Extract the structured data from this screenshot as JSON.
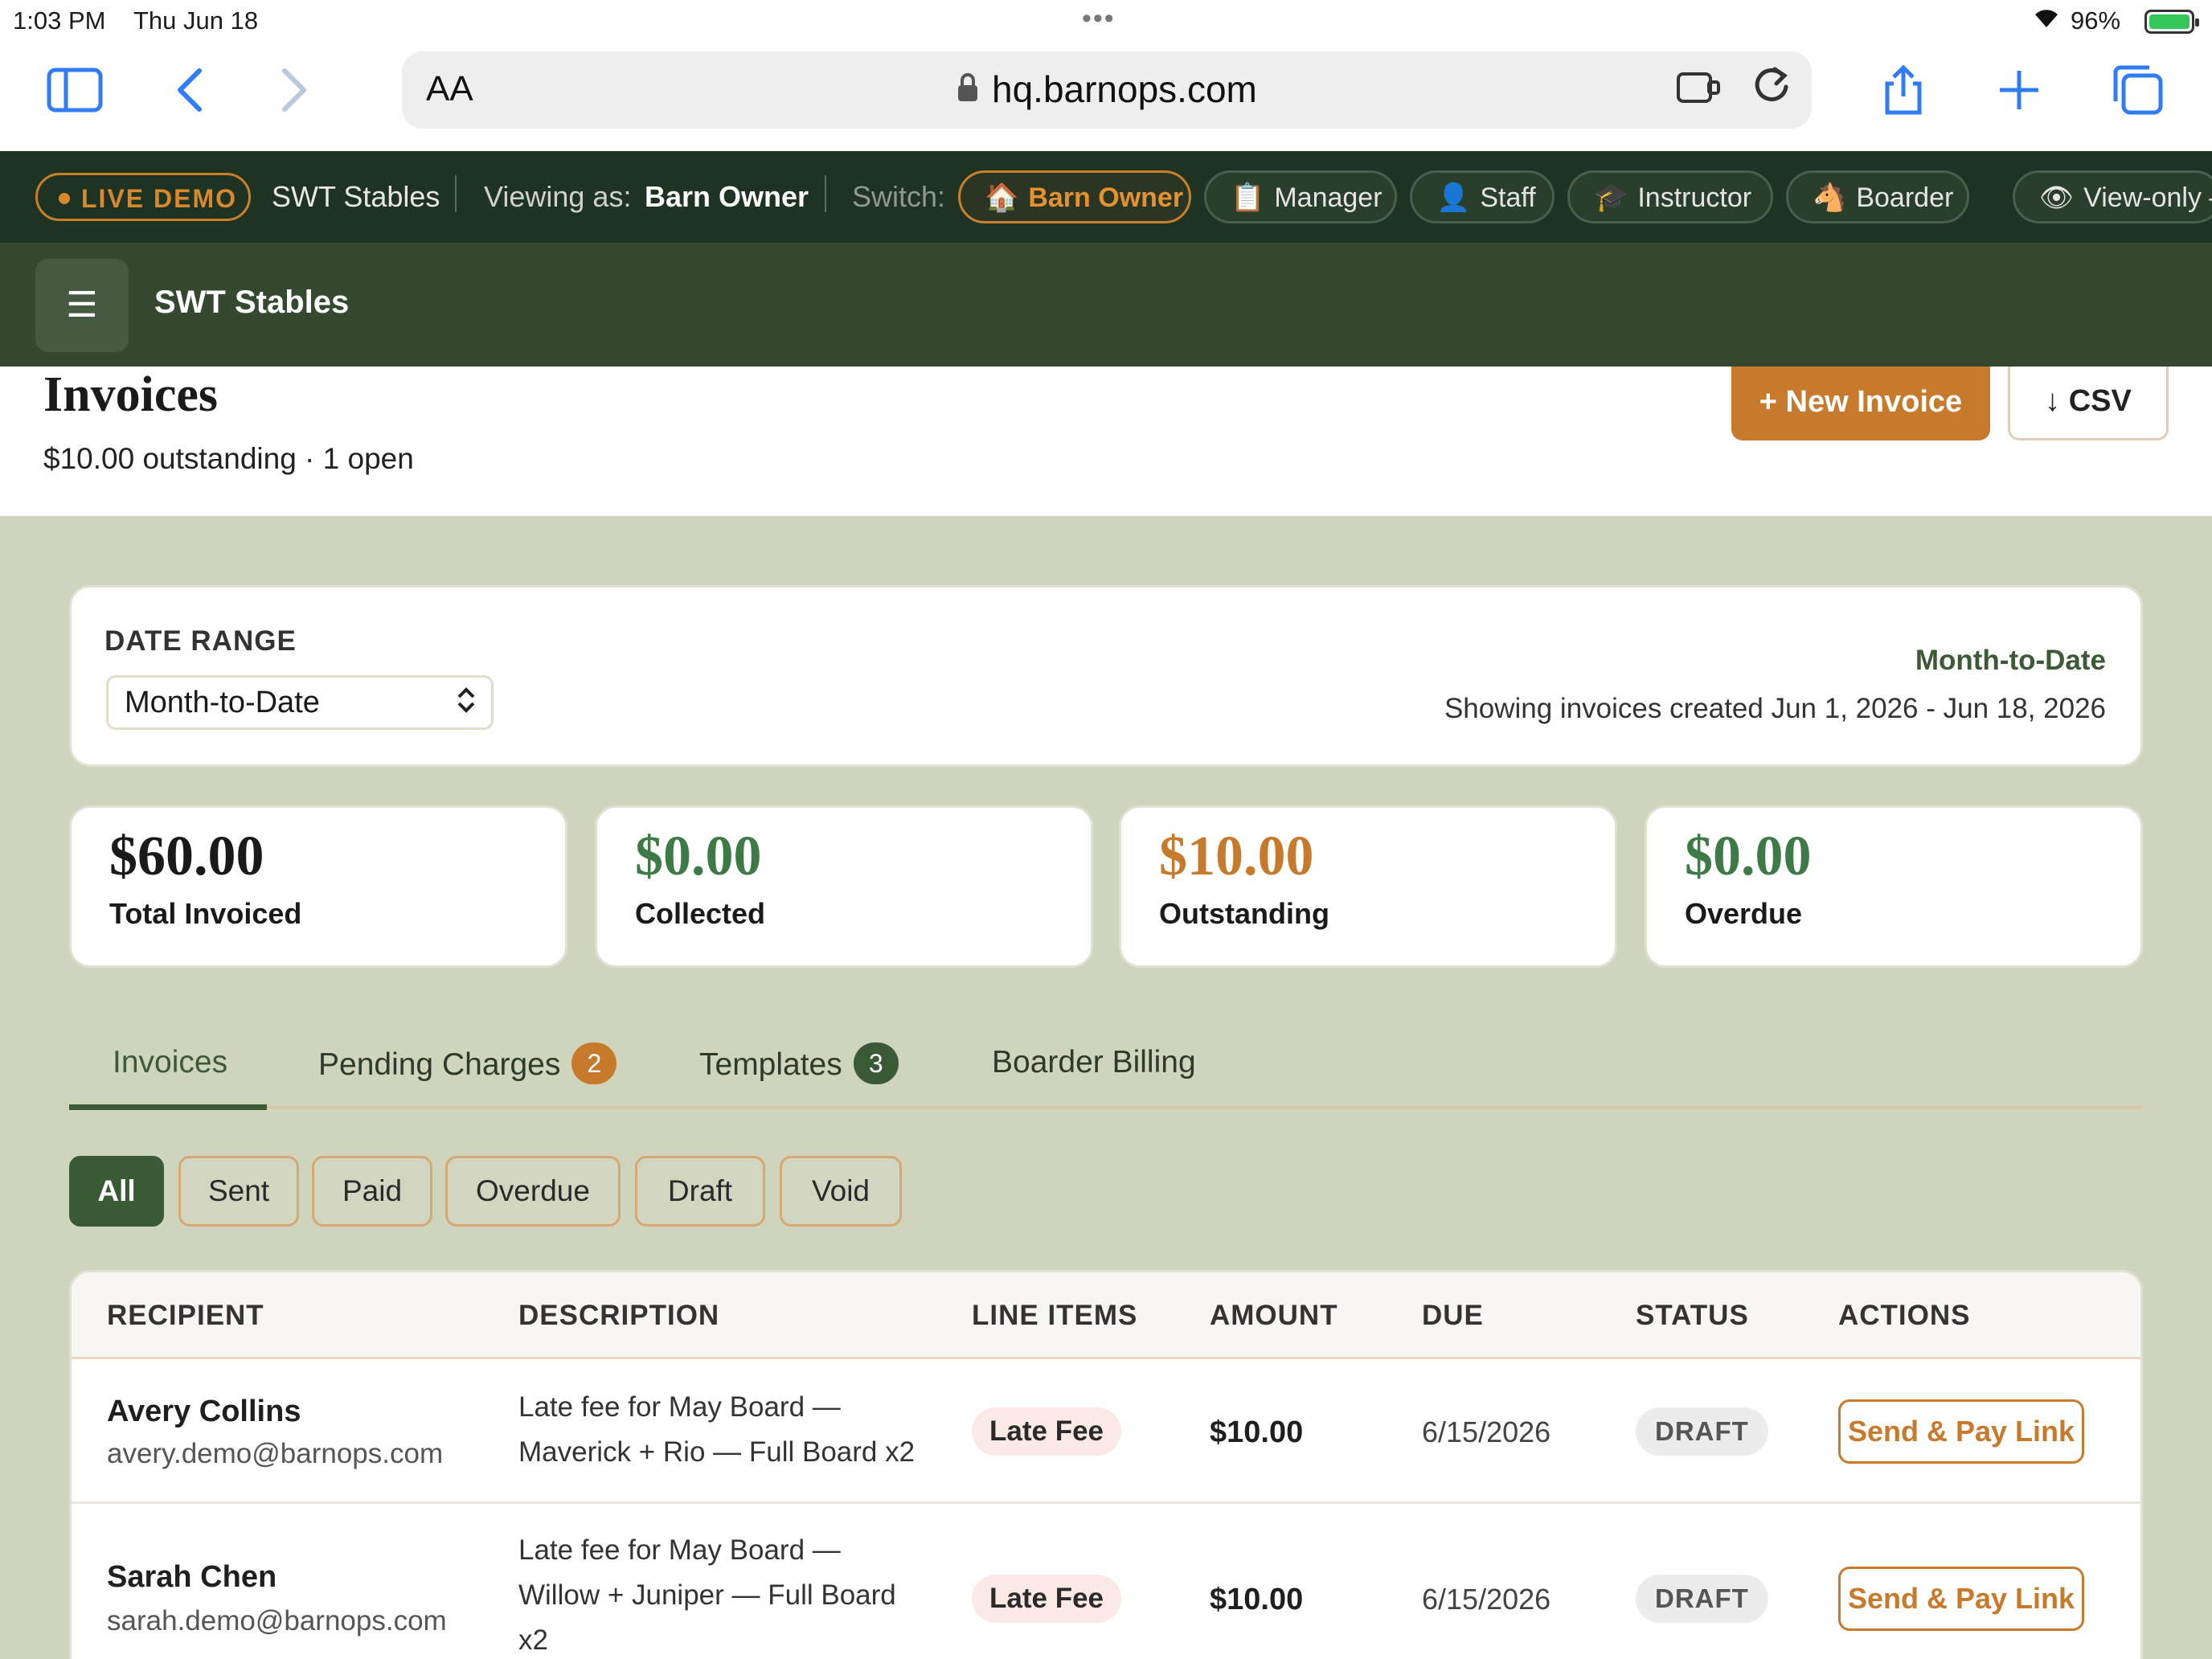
{
  "status_bar": {
    "time": "1:03 PM",
    "date": "Thu Jun 18",
    "battery": "96%"
  },
  "browser": {
    "aa_label": "AA",
    "url": "hq.barnops.com"
  },
  "demo_bar": {
    "live_label": "LIVE DEMO",
    "org": "SWT Stables",
    "viewing_label": "Viewing as:",
    "viewing_role": "Barn Owner",
    "switch_label": "Switch:",
    "roles": [
      {
        "icon": "🏠",
        "label": "Barn Owner"
      },
      {
        "icon": "📋",
        "label": "Manager"
      },
      {
        "icon": "👤",
        "label": "Staff"
      },
      {
        "icon": "🎓",
        "label": "Instructor"
      },
      {
        "icon": "🐴",
        "label": "Boarder"
      },
      {
        "icon": "👁",
        "label": "View-only –"
      }
    ]
  },
  "app_header": {
    "title": "SWT Stables"
  },
  "page": {
    "title": "Invoices",
    "subtitle": "$10.00 outstanding · 1 open",
    "new_invoice_label": "+ New Invoice",
    "csv_label": "↓ CSV"
  },
  "date_range": {
    "label": "DATE RANGE",
    "selected": "Month-to-Date",
    "summary_title": "Month-to-Date",
    "summary_desc": "Showing invoices created Jun 1, 2026 - Jun 18, 2026"
  },
  "stats": [
    {
      "value": "$60.00",
      "label": "Total Invoiced",
      "color": "#1a1a1a"
    },
    {
      "value": "$0.00",
      "label": "Collected",
      "color": "#3d7a45"
    },
    {
      "value": "$10.00",
      "label": "Outstanding",
      "color": "#c87a2c"
    },
    {
      "value": "$0.00",
      "label": "Overdue",
      "color": "#3d7a45"
    }
  ],
  "tabs": [
    {
      "label": "Invoices",
      "badge": ""
    },
    {
      "label": "Pending Charges",
      "badge": "2",
      "badge_color": "#c87a2c"
    },
    {
      "label": "Templates",
      "badge": "3",
      "badge_color": "#3a5a35"
    },
    {
      "label": "Boarder Billing",
      "badge": ""
    }
  ],
  "filters": [
    "All",
    "Sent",
    "Paid",
    "Overdue",
    "Draft",
    "Void"
  ],
  "table": {
    "headers": [
      "RECIPIENT",
      "DESCRIPTION",
      "LINE ITEMS",
      "AMOUNT",
      "DUE",
      "STATUS",
      "ACTIONS"
    ],
    "rows": [
      {
        "name": "Avery Collins",
        "email": "avery.demo@barnops.com",
        "desc_line1": "Late fee for May Board —",
        "desc_line2": "Maverick + Rio — Full Board x2",
        "desc_line3": "",
        "line_item": "Late Fee",
        "amount": "$10.00",
        "due": "6/15/2026",
        "status": "DRAFT",
        "action": "Send & Pay Link"
      },
      {
        "name": "Sarah Chen",
        "email": "sarah.demo@barnops.com",
        "desc_line1": "Late fee for May Board —",
        "desc_line2": "Willow + Juniper — Full Board",
        "desc_line3": "x2",
        "line_item": "Late Fee",
        "amount": "$10.00",
        "due": "6/15/2026",
        "status": "DRAFT",
        "action": "Send & Pay Link"
      }
    ]
  }
}
